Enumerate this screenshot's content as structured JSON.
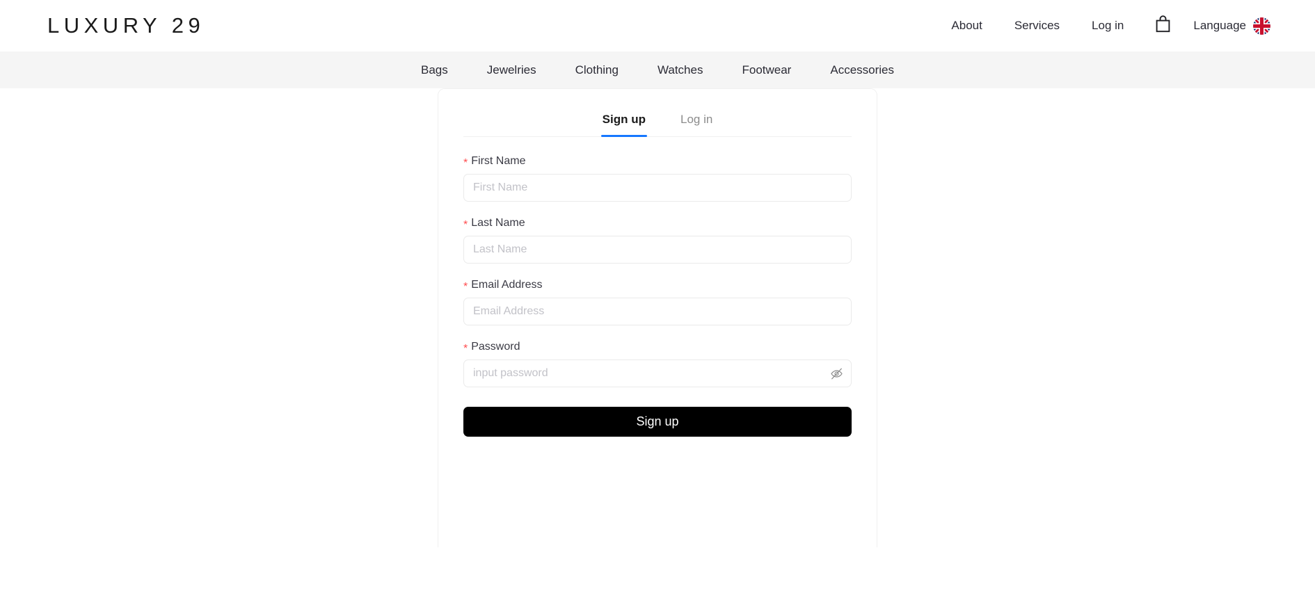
{
  "header": {
    "brand": "LUXURY 29",
    "nav_items": [
      {
        "label": "About",
        "name": "about"
      },
      {
        "label": "Services",
        "name": "services"
      },
      {
        "label": "Log in",
        "name": "log-in"
      }
    ],
    "cart_icon": "shopping-bag-icon",
    "language": {
      "label": "Language",
      "flag_icon": "uk-flag-icon"
    }
  },
  "category_nav": {
    "items": [
      {
        "label": "Bags"
      },
      {
        "label": "Jewelries"
      },
      {
        "label": "Clothing"
      },
      {
        "label": "Watches"
      },
      {
        "label": "Footwear"
      },
      {
        "label": "Accessories"
      }
    ]
  },
  "auth_card": {
    "tabs": [
      {
        "label": "Sign up",
        "active": true
      },
      {
        "label": "Log in",
        "active": false
      }
    ],
    "required_marker": "*",
    "fields": [
      {
        "label": "First Name",
        "placeholder": "First Name",
        "value": "",
        "required": true
      },
      {
        "label": "Last Name",
        "placeholder": "Last Name",
        "value": "",
        "required": true
      },
      {
        "label": "Email Address",
        "placeholder": "Email Address",
        "value": "",
        "required": true
      },
      {
        "label": "Password",
        "placeholder": "input password",
        "value": "",
        "required": true,
        "icon": "eye-slash-icon"
      }
    ],
    "submit_label": "Sign up"
  },
  "colors": {
    "accent_blue": "#1677ff",
    "required_red": "#ff4d4f",
    "button_black": "#000000",
    "catbar_grey": "#f5f5f5",
    "border_grey": "#f0f0f0"
  }
}
